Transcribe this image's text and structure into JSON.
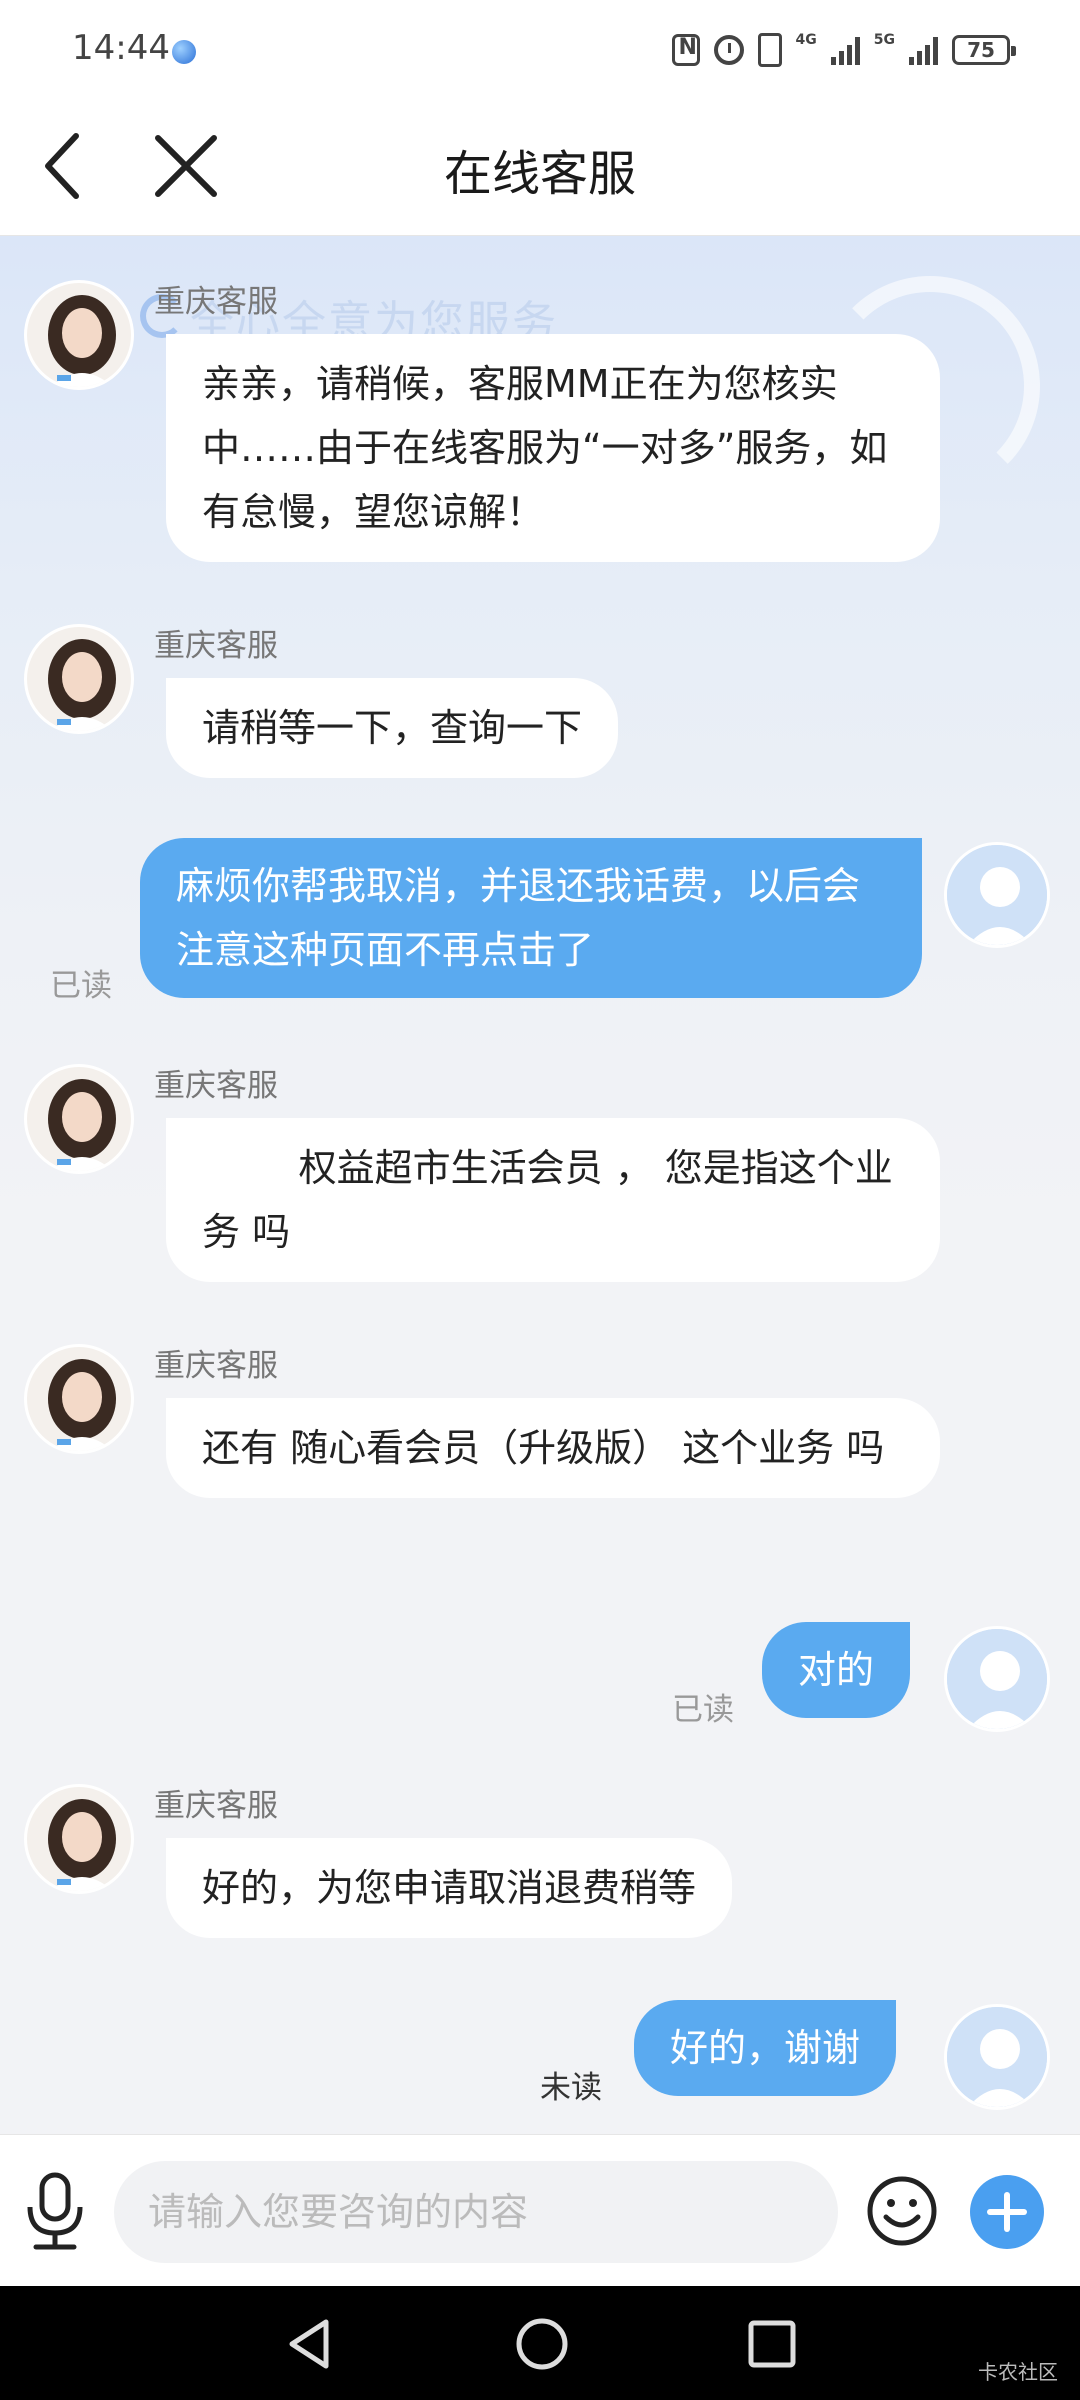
{
  "status_bar": {
    "time": "14:44",
    "battery": "75",
    "network_1": "4G",
    "network_2": "5G"
  },
  "header": {
    "title": "在线客服"
  },
  "banner": {
    "text": "全心全意为您服务"
  },
  "messages": [
    {
      "from": "agent",
      "name": "重庆客服",
      "text": "亲亲，请稍候，客服MM正在为您核实中……由于在线客服为“一对多”服务，如有怠慢，望您谅解！"
    },
    {
      "from": "agent",
      "name": "重庆客服",
      "text": "请稍等一下，查询一下"
    },
    {
      "from": "user",
      "text": "麻烦你帮我取消，并退还我话费，以后会注意这种页面不再点击了",
      "status": "已读"
    },
    {
      "from": "agent",
      "name": "重庆客服",
      "text": "        权益超市生活会员 ， 您是指这个业务 吗"
    },
    {
      "from": "agent",
      "name": "重庆客服",
      "text": "还有 随心看会员（升级版） 这个业务 吗"
    },
    {
      "from": "user",
      "text": "对的",
      "status": "已读"
    },
    {
      "from": "agent",
      "name": "重庆客服",
      "text": "好的，为您申请取消退费稍等"
    },
    {
      "from": "user",
      "text": "好的，谢谢",
      "status": "未读"
    }
  ],
  "input": {
    "placeholder": "请输入您要咨询的内容",
    "value": ""
  },
  "watermark": "卡农社区",
  "colors": {
    "user_bubble": "#5aaaf0",
    "agent_bubble": "#ffffff",
    "accent": "#4a9ff0"
  }
}
